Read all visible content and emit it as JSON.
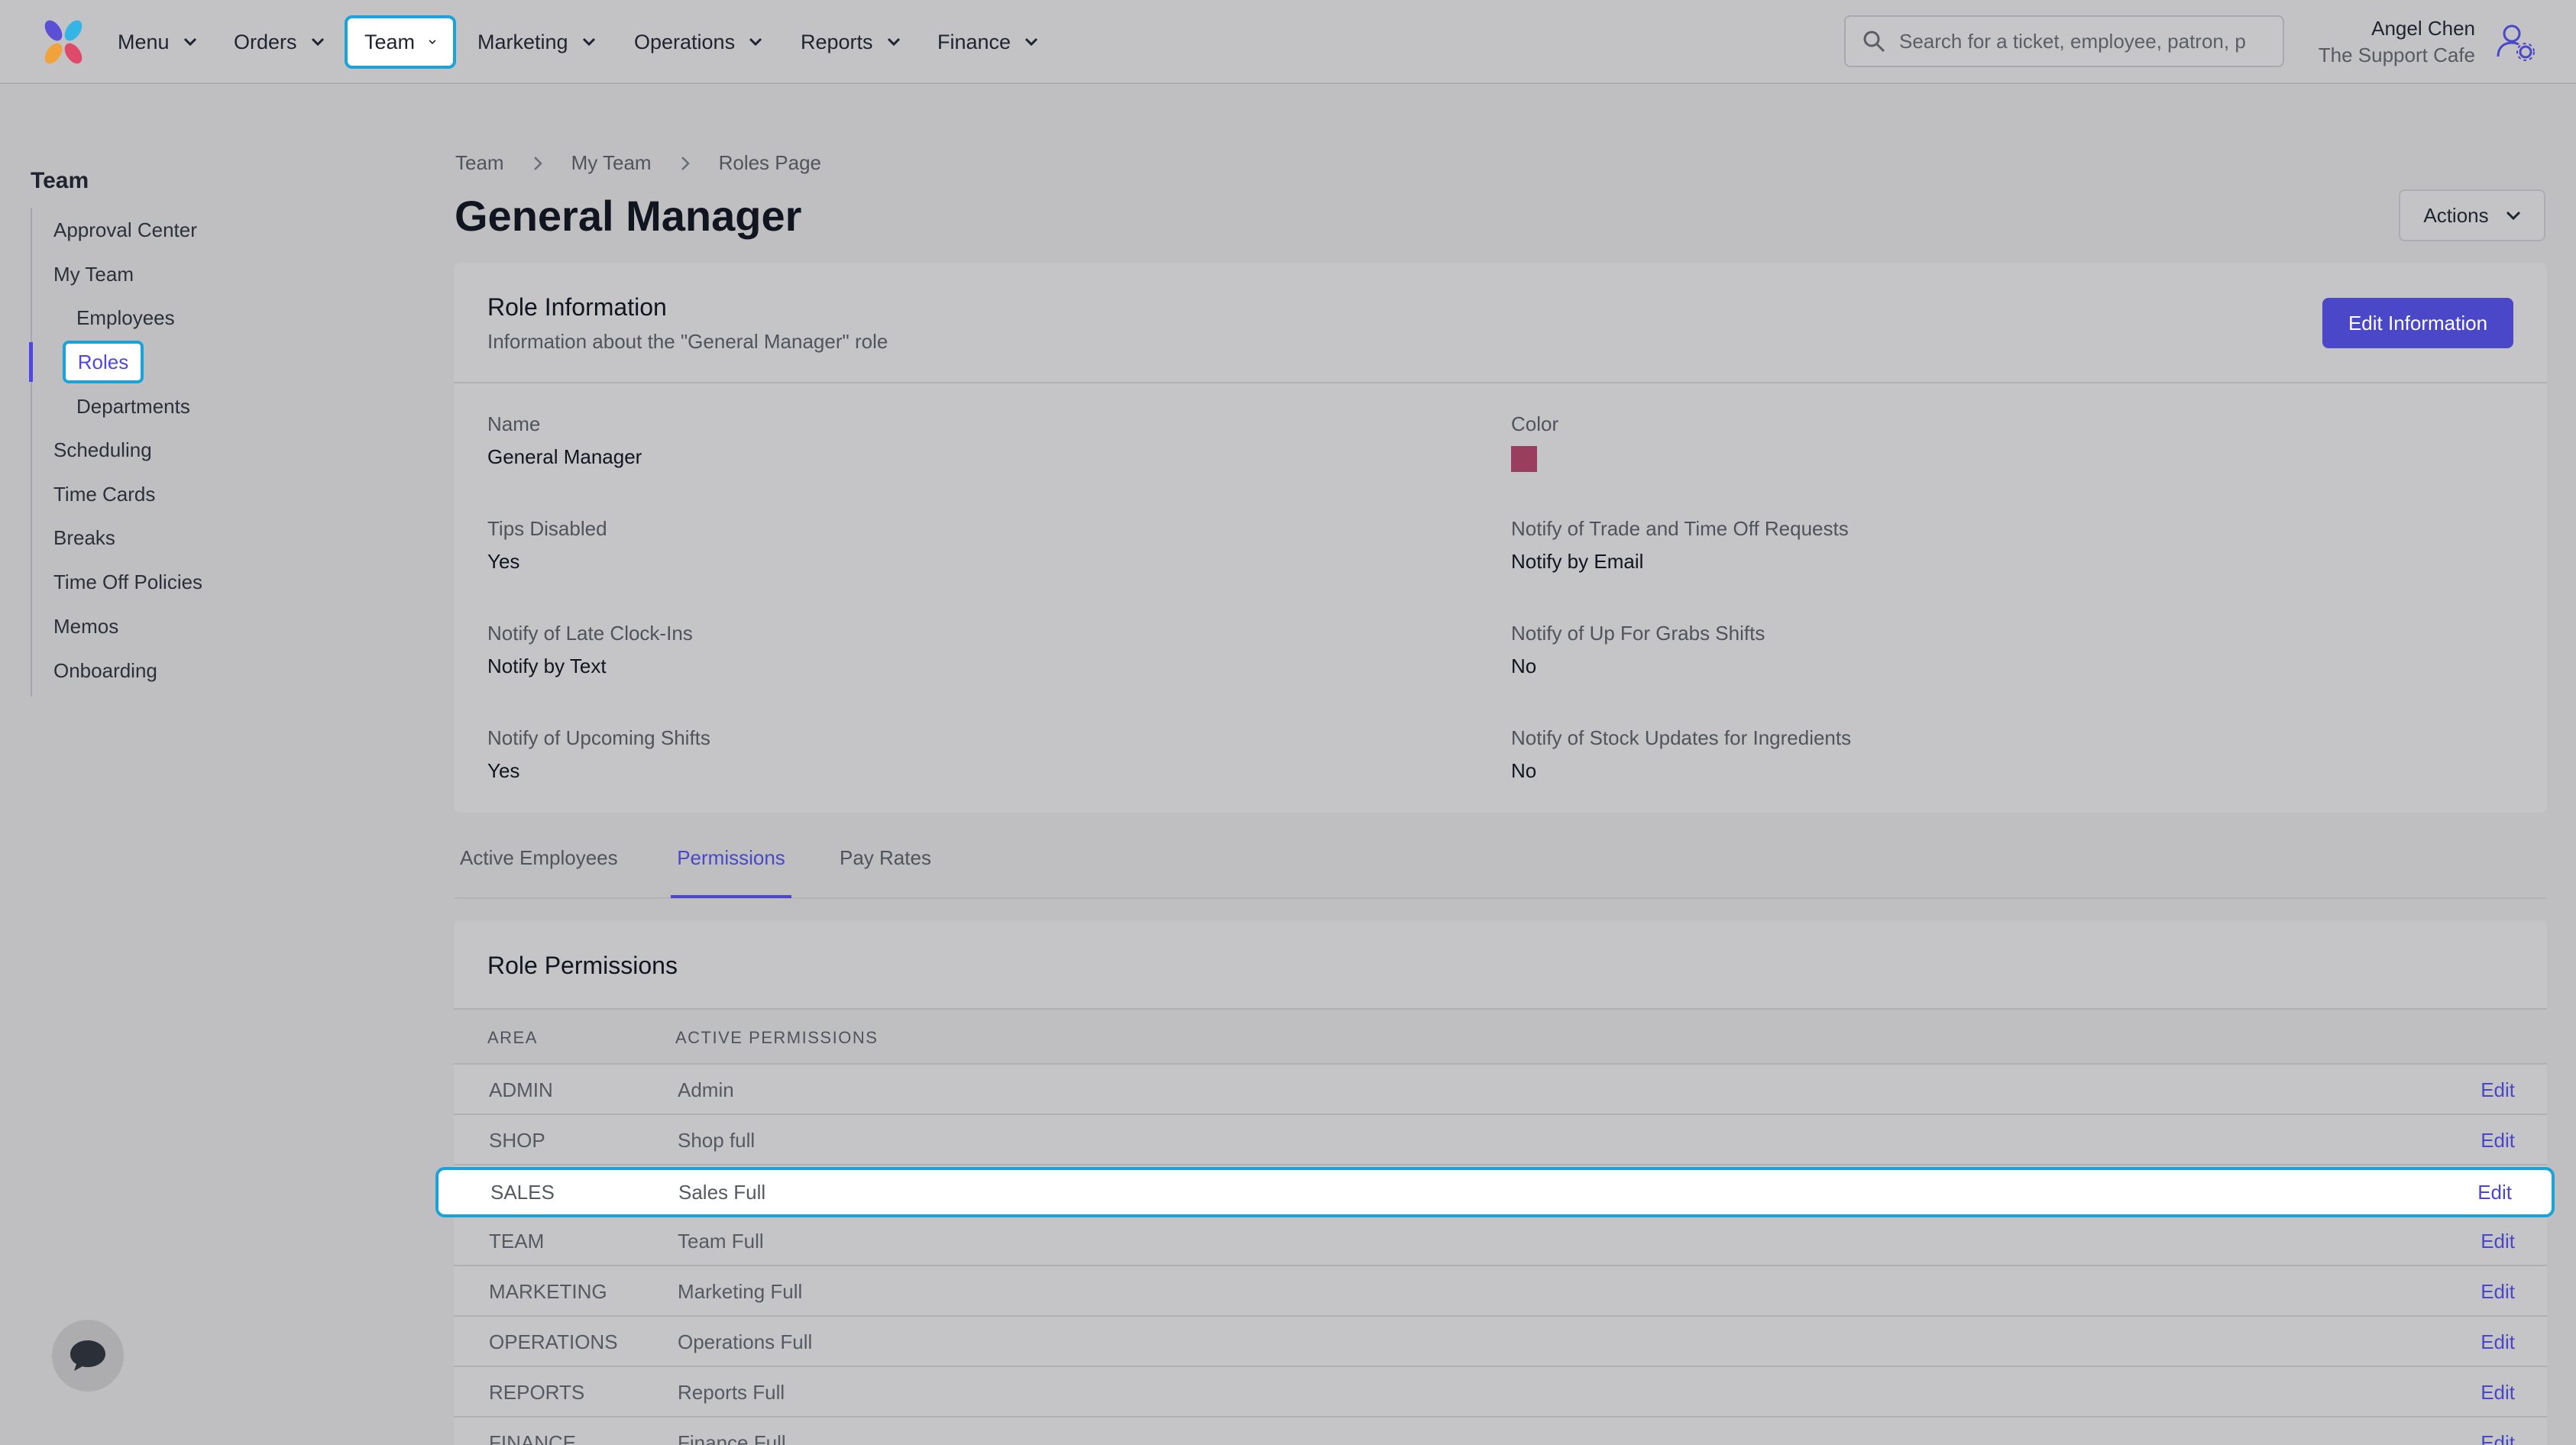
{
  "nav": {
    "items": [
      {
        "label": "Menu"
      },
      {
        "label": "Orders"
      },
      {
        "label": "Team"
      },
      {
        "label": "Marketing"
      },
      {
        "label": "Operations"
      },
      {
        "label": "Reports"
      },
      {
        "label": "Finance"
      }
    ],
    "active": "Team",
    "search_placeholder": "Search for a ticket, employee, patron, p",
    "user_name": "Angel Chen",
    "user_org": "The Support Cafe"
  },
  "sidebar": {
    "title": "Team",
    "items": [
      {
        "label": "Approval Center"
      },
      {
        "label": "My Team"
      },
      {
        "label": "Employees"
      },
      {
        "label": "Roles"
      },
      {
        "label": "Departments"
      },
      {
        "label": "Scheduling"
      },
      {
        "label": "Time Cards"
      },
      {
        "label": "Breaks"
      },
      {
        "label": "Time Off Policies"
      },
      {
        "label": "Memos"
      },
      {
        "label": "Onboarding"
      }
    ]
  },
  "breadcrumb": [
    "Team",
    "My Team",
    "Roles Page"
  ],
  "page_title": "General Manager",
  "actions_label": "Actions",
  "role_info": {
    "title": "Role Information",
    "subtitle": "Information about the \"General Manager\" role",
    "edit_label": "Edit Information",
    "color": "#9a3e5e",
    "fields": {
      "name": {
        "label": "Name",
        "value": "General Manager"
      },
      "color": {
        "label": "Color"
      },
      "tips": {
        "label": "Tips Disabled",
        "value": "Yes"
      },
      "trade": {
        "label": "Notify of Trade and Time Off Requests",
        "value": "Notify by Email"
      },
      "late": {
        "label": "Notify of Late Clock-Ins",
        "value": "Notify by Text"
      },
      "grabs": {
        "label": "Notify of Up For Grabs Shifts",
        "value": "No"
      },
      "upcoming": {
        "label": "Notify of Upcoming Shifts",
        "value": "Yes"
      },
      "stock": {
        "label": "Notify of Stock Updates for Ingredients",
        "value": "No"
      }
    }
  },
  "tabs": [
    {
      "label": "Active Employees"
    },
    {
      "label": "Permissions"
    },
    {
      "label": "Pay Rates"
    }
  ],
  "permissions": {
    "title": "Role Permissions",
    "col_area": "AREA",
    "col_active": "ACTIVE PERMISSIONS",
    "edit_label": "Edit",
    "rows": [
      {
        "area": "ADMIN",
        "perm": "Admin"
      },
      {
        "area": "SHOP",
        "perm": "Shop full"
      },
      {
        "area": "SALES",
        "perm": "Sales Full"
      },
      {
        "area": "TEAM",
        "perm": "Team Full"
      },
      {
        "area": "MARKETING",
        "perm": "Marketing Full"
      },
      {
        "area": "OPERATIONS",
        "perm": "Operations Full"
      },
      {
        "area": "REPORTS",
        "perm": "Reports Full"
      },
      {
        "area": "FINANCE",
        "perm": "Finance Full"
      }
    ]
  }
}
